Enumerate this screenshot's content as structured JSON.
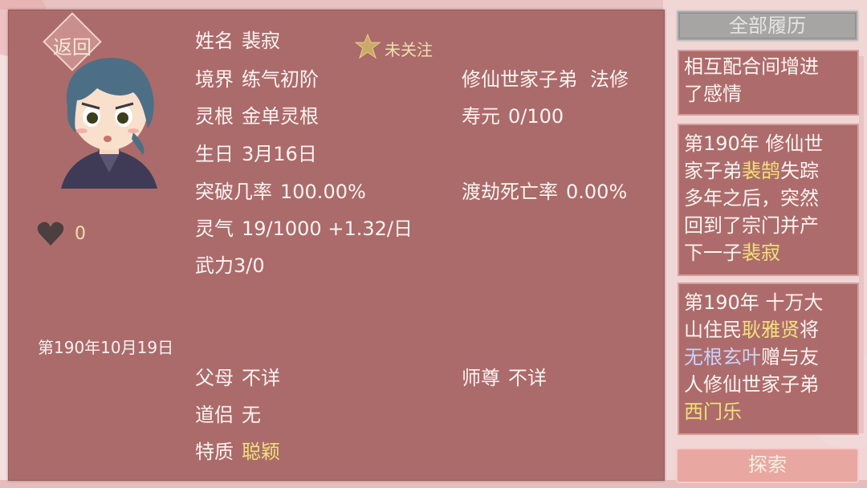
{
  "header": {
    "back_label": "返回",
    "follow_label": "未关注"
  },
  "profile": {
    "name_label": "姓名",
    "name": "裴寂",
    "realm_label": "境界",
    "realm": "练气初阶",
    "root_label": "灵根",
    "root": "金单灵根",
    "birthday_label": "生日",
    "birthday": "3月16日",
    "breakthrough_label": "突破几率",
    "breakthrough": "100.00%",
    "qi_label": "灵气",
    "qi": "19/1000 +1.32/日",
    "force_text": "武力3/0",
    "identity": "修仙世家子弟",
    "school": "法修",
    "lifespan_label": "寿元",
    "lifespan": "0/100",
    "tribulation_label": "渡劫死亡率",
    "tribulation": "0.00%",
    "likes": "0",
    "date": "第190年10月19日",
    "parents_label": "父母",
    "parents": "不详",
    "master_label": "师尊",
    "master": "不详",
    "partner_label": "道侣",
    "partner": "无",
    "trait_label": "特质",
    "trait": "聪颖"
  },
  "sidebar": {
    "history_button": "全部履历",
    "explore_button": "探索",
    "entries": [
      {
        "l1": "相互配合间增进",
        "l2": "了感情"
      },
      {
        "a1": "第190年 修仙世",
        "a2": "家子弟",
        "a3": "裴鹄",
        "a4": "失踪",
        "a5": "多年之后，突然",
        "a6": "回到了宗门并产",
        "a7": "下一子",
        "a8": "裴寂"
      },
      {
        "b1": "第190年 十万大",
        "b2": "山住民",
        "b3": "耿雅贤",
        "b4": "将",
        "b5": "无根玄叶",
        "b6": "赠与友",
        "b7": "人修仙世家子弟",
        "b8": "西门乐"
      }
    ]
  },
  "colors": {
    "panel": "#ab6b6a",
    "gold": "#f0e07a",
    "blue": "#c9d2ff"
  }
}
